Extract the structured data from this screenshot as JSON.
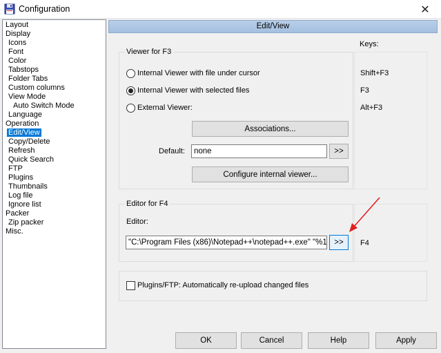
{
  "window": {
    "title": "Configuration"
  },
  "tree": {
    "items": [
      {
        "label": "Layout",
        "level": 0
      },
      {
        "label": "Display",
        "level": 0
      },
      {
        "label": "Icons",
        "level": 1
      },
      {
        "label": "Font",
        "level": 1
      },
      {
        "label": "Color",
        "level": 1
      },
      {
        "label": "Tabstops",
        "level": 1
      },
      {
        "label": "Folder Tabs",
        "level": 1
      },
      {
        "label": "Custom columns",
        "level": 1
      },
      {
        "label": "View Mode",
        "level": 1
      },
      {
        "label": "Auto Switch Mode",
        "level": 2
      },
      {
        "label": "Language",
        "level": 1
      },
      {
        "label": "Operation",
        "level": 0
      },
      {
        "label": "Edit/View",
        "level": 1,
        "selected": true
      },
      {
        "label": "Copy/Delete",
        "level": 1
      },
      {
        "label": "Refresh",
        "level": 1
      },
      {
        "label": "Quick Search",
        "level": 1
      },
      {
        "label": "FTP",
        "level": 1
      },
      {
        "label": "Plugins",
        "level": 1
      },
      {
        "label": "Thumbnails",
        "level": 1
      },
      {
        "label": "Log file",
        "level": 1
      },
      {
        "label": "Ignore list",
        "level": 1
      },
      {
        "label": "Packer",
        "level": 0
      },
      {
        "label": "Zip packer",
        "level": 1
      },
      {
        "label": "Misc.",
        "level": 0
      }
    ]
  },
  "panel": {
    "header": "Edit/View",
    "keys_label": "Keys:",
    "viewer": {
      "title": "Viewer for F3",
      "option_internal_cursor": "Internal Viewer with file under cursor",
      "option_internal_selected": "Internal Viewer with selected files",
      "option_external": "External Viewer:",
      "associations_button": "Associations...",
      "default_label": "Default:",
      "default_value": "none",
      "browse_button": ">>",
      "configure_button": "Configure internal viewer..."
    },
    "keys": {
      "shift_f3": "Shift+F3",
      "f3": "F3",
      "alt_f3": "Alt+F3",
      "f4": "F4"
    },
    "editor": {
      "title": "Editor for F4",
      "editor_label": "Editor:",
      "editor_value": "\"C:\\Program Files (x86)\\Notepad++\\notepad++.exe\" \"%1\"",
      "browse_button": ">>"
    },
    "reupload_label": "Plugins/FTP: Automatically re-upload changed files"
  },
  "footer": {
    "ok": "OK",
    "cancel": "Cancel",
    "help": "Help",
    "apply": "Apply"
  },
  "colors": {
    "selection": "#0078d7",
    "header": "#b9cfe8",
    "arrow": "#e02020"
  }
}
